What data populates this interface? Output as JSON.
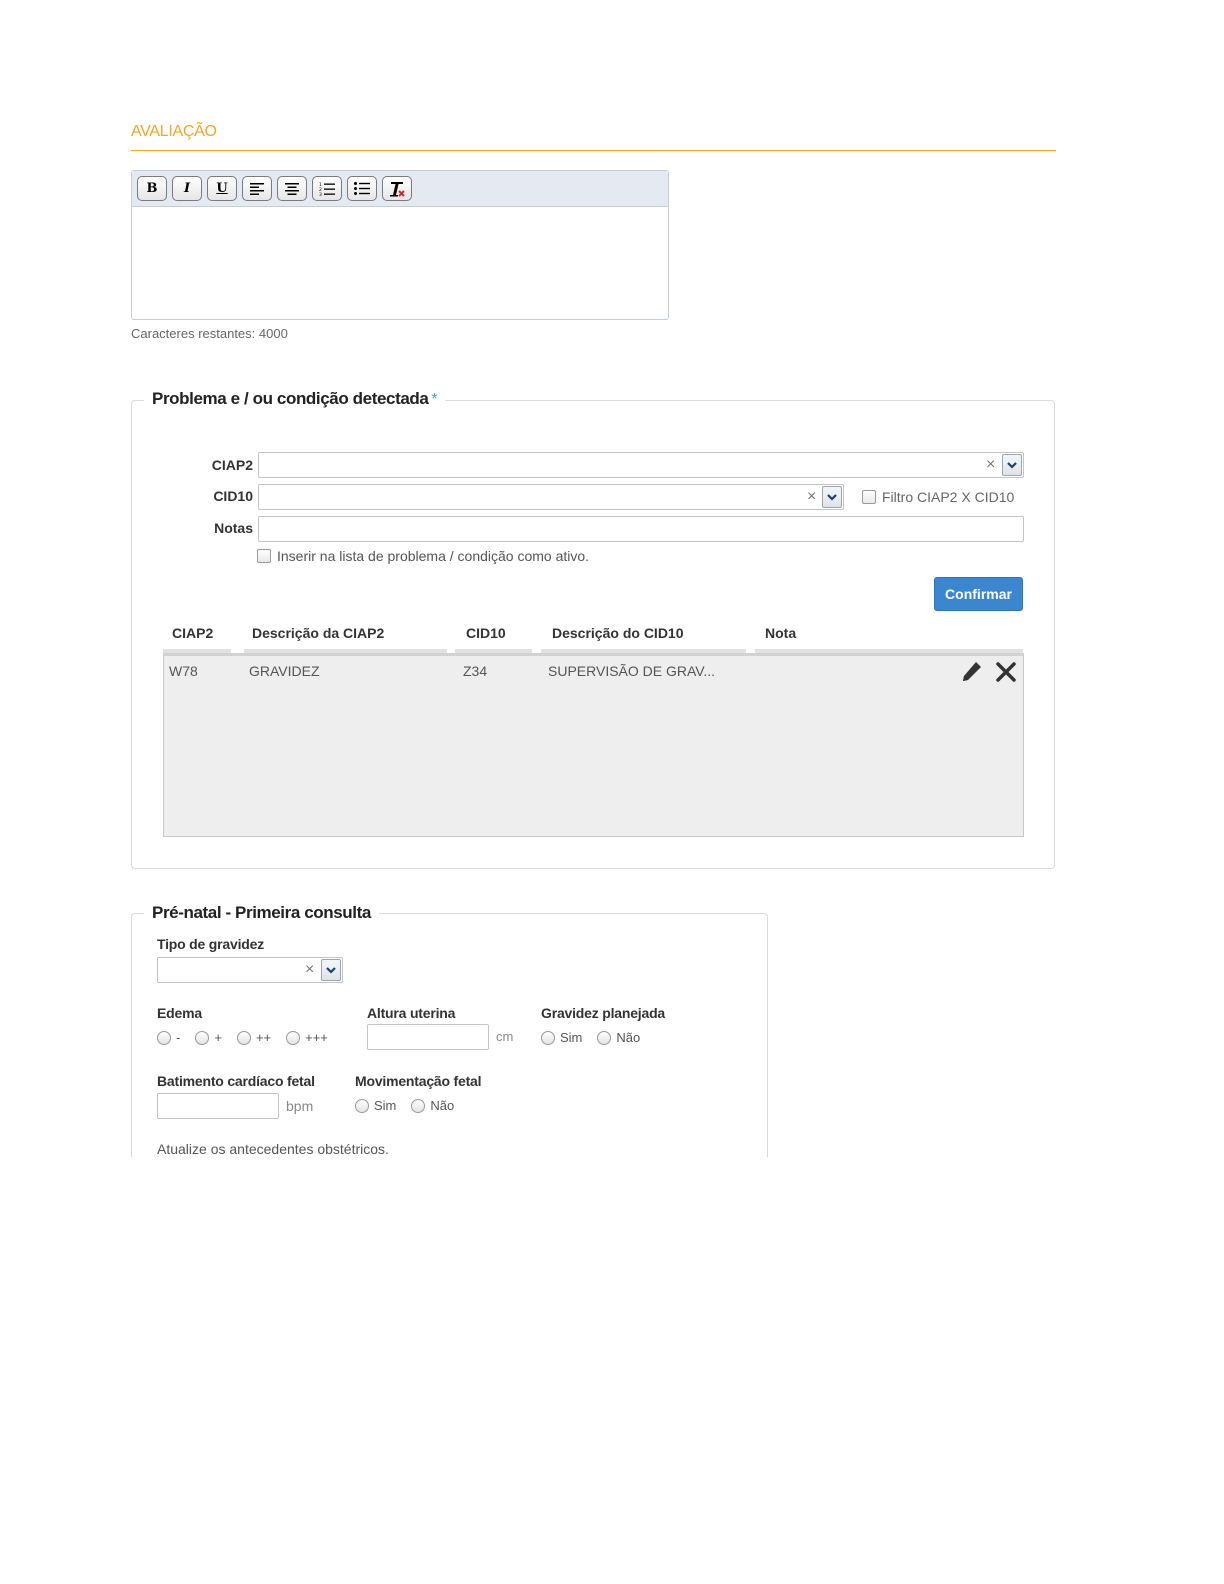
{
  "section": {
    "title": "AVALIAÇÃO"
  },
  "editor": {
    "toolbar": [
      "bold",
      "italic",
      "underline",
      "align-left",
      "align-center",
      "ordered-list",
      "unordered-list",
      "clear-format"
    ],
    "bold_label": "B",
    "italic_label": "I",
    "underline_label": "U",
    "char_count": "Caracteres restantes: 4000"
  },
  "problema": {
    "legend": "Problema e / ou condição detectada",
    "required_mark": "*",
    "ciap2_label": "CIAP2",
    "cid10_label": "CID10",
    "notas_label": "Notas",
    "clear_glyph": "×",
    "filter_label": "Filtro CIAP2 X CID10",
    "checkbox_label": "Inserir na lista de problema / condição como ativo.",
    "confirm_label": "Confirmar",
    "table": {
      "headers": [
        "CIAP2",
        "Descrição da CIAP2",
        "CID10",
        "Descrição do CID10",
        "Nota"
      ],
      "rows": [
        {
          "ciap2": "W78",
          "desc_ciap2": "GRAVIDEZ",
          "cid10": "Z34",
          "desc_cid10": "SUPERVISÃO DE GRAV...",
          "nota": ""
        }
      ]
    }
  },
  "prenatal": {
    "legend": "Pré-natal - Primeira consulta",
    "tipo_label": "Tipo de gravidez",
    "edema_label": "Edema",
    "edema_options": [
      "-",
      "+",
      "++",
      "+++"
    ],
    "altura_label": "Altura uterina",
    "altura_unit": "cm",
    "planejada_label": "Gravidez planejada",
    "sim": "Sim",
    "nao": "Não",
    "bcf_label": "Batimento cardíaco fetal",
    "bcf_unit": "bpm",
    "mov_label": "Movimentação fetal",
    "note": "Atualize os antecedentes obstétricos."
  }
}
